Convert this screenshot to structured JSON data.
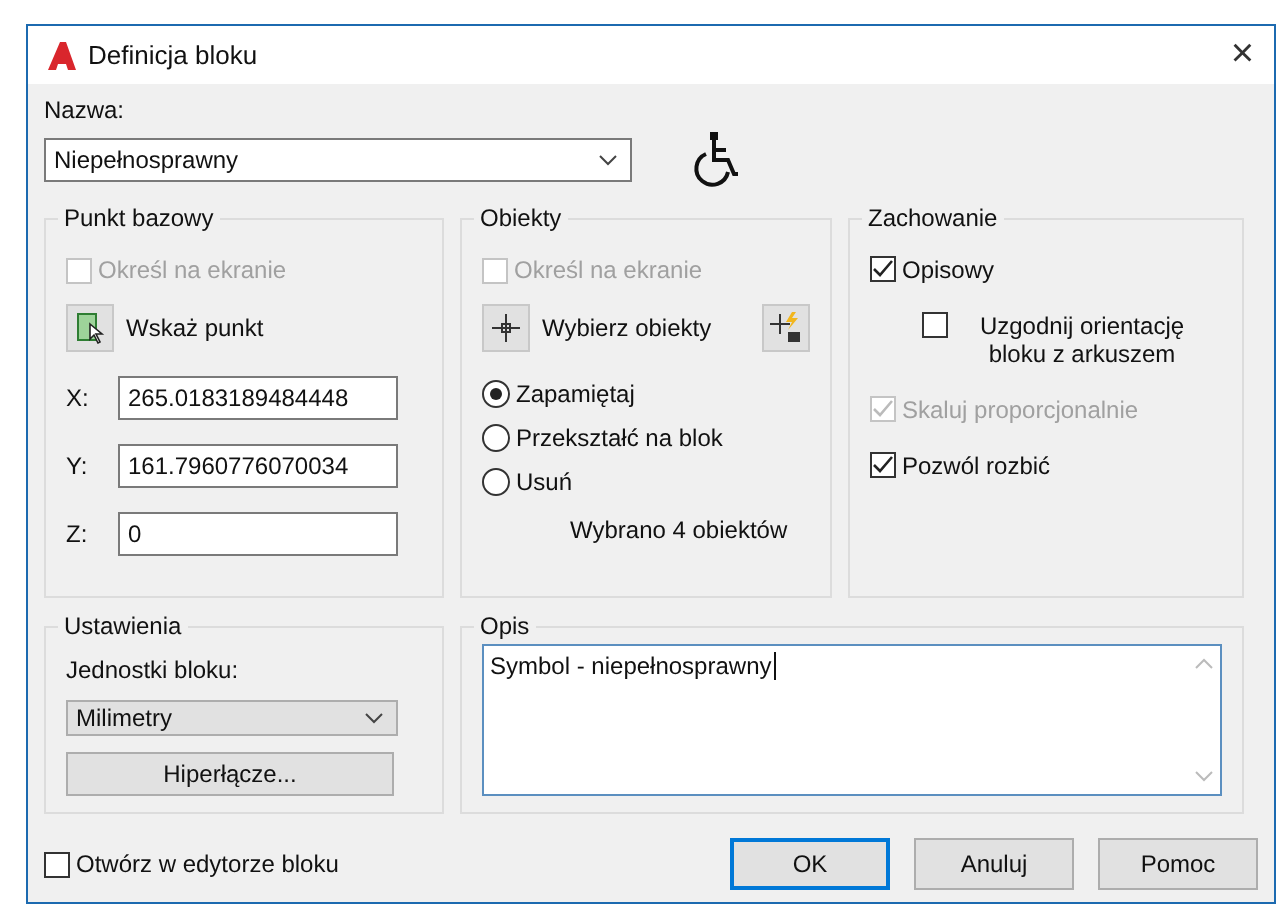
{
  "window": {
    "title": "Definicja bloku",
    "close": "×"
  },
  "name": {
    "label": "Nazwa:",
    "value": "Niepełnosprawny"
  },
  "base_point": {
    "title": "Punkt bazowy",
    "specify_on_screen": {
      "label": "Określ na ekranie",
      "checked": false,
      "disabled": true
    },
    "pick_button": "Wskaż punkt",
    "coords": [
      {
        "label": "X:",
        "value": "265.0183189484448"
      },
      {
        "label": "Y:",
        "value": "161.7960776070034"
      },
      {
        "label": "Z:",
        "value": "0"
      }
    ]
  },
  "objects": {
    "title": "Obiekty",
    "specify_on_screen": {
      "label": "Określ na ekranie",
      "checked": false,
      "disabled": true
    },
    "select_button": "Wybierz obiekty",
    "options": [
      {
        "label": "Zapamiętaj",
        "selected": true
      },
      {
        "label": "Przekształć na blok",
        "selected": false
      },
      {
        "label": "Usuń",
        "selected": false
      }
    ],
    "status": "Wybrano 4 obiektów"
  },
  "behavior": {
    "title": "Zachowanie",
    "options": [
      {
        "label": "Opisowy",
        "checked": true,
        "disabled": false,
        "indented": false
      },
      {
        "label": "Uzgodnij orientację bloku z arkuszem",
        "checked": false,
        "disabled": false,
        "indented": true
      },
      {
        "label": "Skaluj proporcjonalnie",
        "checked": true,
        "disabled": true,
        "indented": false
      },
      {
        "label": "Pozwól rozbić",
        "checked": true,
        "disabled": false,
        "indented": false
      }
    ]
  },
  "settings": {
    "title": "Ustawienia",
    "units_label": "Jednostki bloku:",
    "units_value": "Milimetry",
    "hyperlink_button": "Hiperłącze..."
  },
  "description": {
    "title": "Opis",
    "value": "Symbol - niepełnosprawny"
  },
  "open_in_editor": {
    "label": "Otwórz w edytorze bloku",
    "checked": false
  },
  "buttons": [
    {
      "label": "OK",
      "default": true
    },
    {
      "label": "Anuluj",
      "default": false
    },
    {
      "label": "Pomoc",
      "default": false
    }
  ]
}
